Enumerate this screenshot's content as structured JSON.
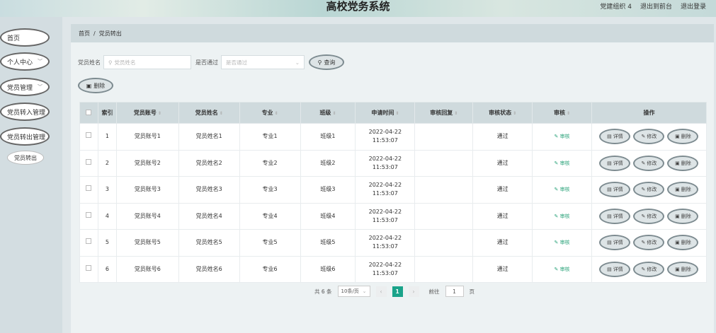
{
  "header": {
    "title": "高校党务系统",
    "user_label": "党建组织 4",
    "back_label": "退出到前台",
    "logout_label": "退出登录"
  },
  "sidebar": {
    "items": [
      {
        "label": "首页"
      },
      {
        "label": "个人中心"
      },
      {
        "label": "党员管理"
      },
      {
        "label": "党员转入管理"
      },
      {
        "label": "党员转出管理"
      }
    ],
    "sub_item": "党员转出"
  },
  "breadcrumb": {
    "home": "首页",
    "sep": "/",
    "current": "党员转出"
  },
  "search": {
    "name_label": "党员姓名",
    "name_placeholder": "党员姓名",
    "pass_label": "是否通过",
    "pass_placeholder": "是否通过",
    "query_label": "查询",
    "delete_label": "删除"
  },
  "table": {
    "headers": [
      "索引",
      "党员账号",
      "党员姓名",
      "专业",
      "班级",
      "申请时间",
      "审核回复",
      "审核状态",
      "审核",
      "操作"
    ],
    "audit_link": "审核",
    "ops": {
      "detail": "详情",
      "edit": "修改",
      "delete": "删除"
    },
    "rows": [
      {
        "idx": "1",
        "account": "党员账号1",
        "name": "党员姓名1",
        "major": "专业1",
        "cls": "班级1",
        "time": "2022-04-22 11:53:07",
        "reply": "",
        "status": "通过"
      },
      {
        "idx": "2",
        "account": "党员账号2",
        "name": "党员姓名2",
        "major": "专业2",
        "cls": "班级2",
        "time": "2022-04-22 11:53:07",
        "reply": "",
        "status": "通过"
      },
      {
        "idx": "3",
        "account": "党员账号3",
        "name": "党员姓名3",
        "major": "专业3",
        "cls": "班级3",
        "time": "2022-04-22 11:53:07",
        "reply": "",
        "status": "通过"
      },
      {
        "idx": "4",
        "account": "党员账号4",
        "name": "党员姓名4",
        "major": "专业4",
        "cls": "班级4",
        "time": "2022-04-22 11:53:07",
        "reply": "",
        "status": "通过"
      },
      {
        "idx": "5",
        "account": "党员账号5",
        "name": "党员姓名5",
        "major": "专业5",
        "cls": "班级5",
        "time": "2022-04-22 11:53:07",
        "reply": "",
        "status": "通过"
      },
      {
        "idx": "6",
        "account": "党员账号6",
        "name": "党员姓名6",
        "major": "专业6",
        "cls": "班级6",
        "time": "2022-04-22 11:53:07",
        "reply": "",
        "status": "通过"
      }
    ]
  },
  "pagination": {
    "total": "共 6 条",
    "page_size": "10条/页",
    "current_page": "1",
    "goto_label": "前往",
    "goto_value": "1",
    "page_unit": "页"
  }
}
